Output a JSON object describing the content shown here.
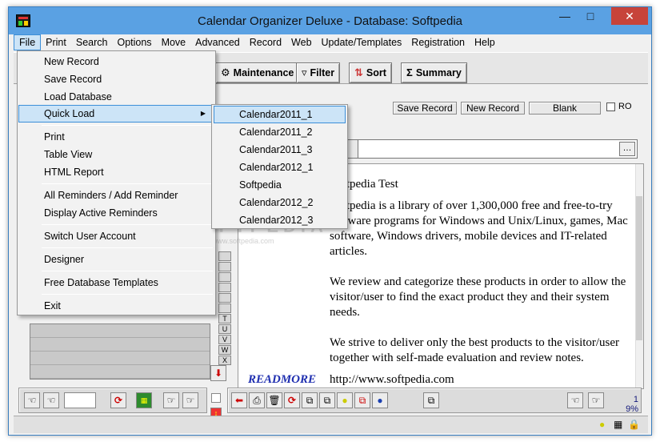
{
  "window": {
    "title": "Calendar Organizer Deluxe - Database: Softpedia"
  },
  "menubar": [
    "File",
    "Print",
    "Search",
    "Options",
    "Move",
    "Advanced",
    "Record",
    "Web",
    "Update/Templates",
    "Registration",
    "Help"
  ],
  "toolbar": {
    "maintenance": "Maintenance",
    "filter": "Filter",
    "sort": "Sort",
    "summary": "Summary"
  },
  "record_bar": {
    "save": "Save Record",
    "new": "New Record",
    "blank": "Blank",
    "ro": "RO"
  },
  "file_menu": [
    "New Record",
    "Save Record",
    "Load Database",
    "Quick Load",
    "Print",
    "Table View",
    "HTML Report",
    "All Reminders / Add Reminder",
    "Display Active Reminders",
    "Switch User Account",
    "Designer",
    "Free Database Templates",
    "Exit"
  ],
  "quick_load_menu": [
    "Calendar2011_1",
    "Calendar2011_2",
    "Calendar2011_3",
    "Calendar2012_1",
    "Softpedia",
    "Calendar2012_2",
    "Calendar2012_3"
  ],
  "document": {
    "title": "Softpedia Test",
    "p1": "Softpedia is a library of over 1,300,000 free and free-to-try software programs for Windows and Unix/Linux, games, Mac software, Windows drivers, mobile devices and IT-related articles.",
    "p2": "We review and categorize these products in order to allow the visitor/user to find the exact product they and their system needs.",
    "p3": "We strive to deliver only the best products to the visitor/user together with self-made evaluation and review notes.",
    "readmore": "READMORE",
    "url": "http://www.softpedia.com"
  },
  "alpha_index": [
    "T",
    "U",
    "V",
    "W",
    "X"
  ],
  "counter": {
    "record": "1",
    "percent": "9%"
  },
  "watermark": {
    "main": "SOFTPEDIA",
    "sub": "www.softpedia.com"
  },
  "colors": {
    "titlebar": "#5aa1e3",
    "close": "#c7433a",
    "readmore": "#1f2fb0",
    "menu_highlight": "#cce4f7"
  }
}
